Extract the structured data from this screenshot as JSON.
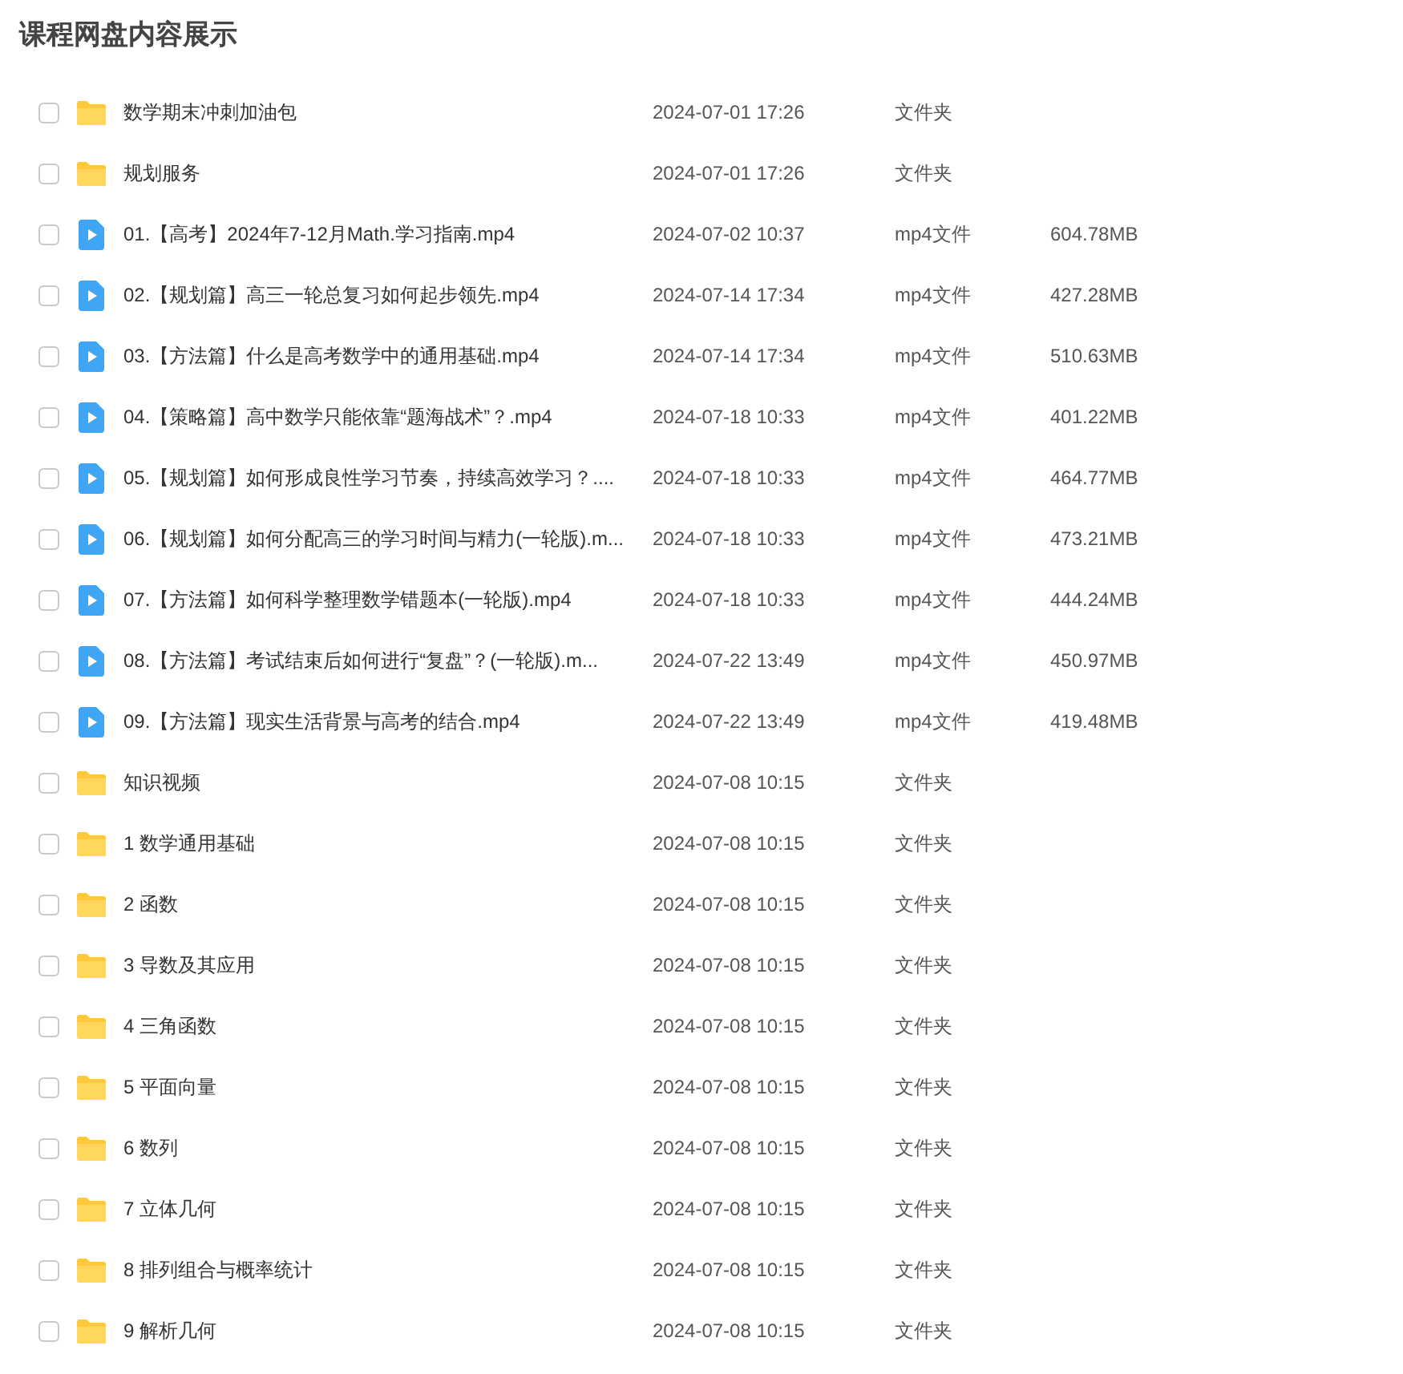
{
  "title": "课程网盘内容展示",
  "files": [
    {
      "kind": "folder",
      "checked": false,
      "name": "数学期末冲刺加油包",
      "date": "2024-07-01 17:26",
      "type": "文件夹"
    },
    {
      "kind": "folder",
      "checked": false,
      "name": "规划服务",
      "date": "2024-07-01 17:26",
      "type": "文件夹"
    },
    {
      "kind": "video",
      "checked": false,
      "name": "01.【高考】2024年7-12月Math.学习指南.mp4",
      "date": "2024-07-02 10:37",
      "type": "mp4文件",
      "size": "604.78MB"
    },
    {
      "kind": "video",
      "checked": false,
      "name": "02.【规划篇】高三一轮总复习如何起步领先.mp4",
      "date": "2024-07-14 17:34",
      "type": "mp4文件",
      "size": "427.28MB"
    },
    {
      "kind": "video",
      "checked": false,
      "name": "03.【方法篇】什么是高考数学中的通用基础.mp4",
      "date": "2024-07-14 17:34",
      "type": "mp4文件",
      "size": "510.63MB"
    },
    {
      "kind": "video",
      "checked": false,
      "name": "04.【策略篇】高中数学只能依靠“题海战术”？.mp4",
      "date": "2024-07-18 10:33",
      "type": "mp4文件",
      "size": "401.22MB"
    },
    {
      "kind": "video",
      "checked": false,
      "name": "05.【规划篇】如何形成良性学习节奏，持续高效学习？....",
      "date": "2024-07-18 10:33",
      "type": "mp4文件",
      "size": "464.77MB"
    },
    {
      "kind": "video",
      "checked": false,
      "name": "06.【规划篇】如何分配高三的学习时间与精力(一轮版).m...",
      "date": "2024-07-18 10:33",
      "type": "mp4文件",
      "size": "473.21MB"
    },
    {
      "kind": "video",
      "checked": false,
      "name": "07.【方法篇】如何科学整理数学错题本(一轮版).mp4",
      "date": "2024-07-18 10:33",
      "type": "mp4文件",
      "size": "444.24MB"
    },
    {
      "kind": "video",
      "checked": false,
      "name": "08.【方法篇】考试结束后如何进行“复盘”？(一轮版).m...",
      "date": "2024-07-22 13:49",
      "type": "mp4文件",
      "size": "450.97MB"
    },
    {
      "kind": "video",
      "checked": false,
      "name": "09.【方法篇】现实生活背景与高考的结合.mp4",
      "date": "2024-07-22 13:49",
      "type": "mp4文件",
      "size": "419.48MB"
    },
    {
      "kind": "folder",
      "checked": false,
      "name": "知识视频",
      "date": "2024-07-08 10:15",
      "type": "文件夹"
    },
    {
      "kind": "folder",
      "checked": false,
      "name": "1 数学通用基础",
      "date": "2024-07-08 10:15",
      "type": "文件夹"
    },
    {
      "kind": "folder",
      "checked": false,
      "name": "2 函数",
      "date": "2024-07-08 10:15",
      "type": "文件夹"
    },
    {
      "kind": "folder",
      "checked": false,
      "name": "3 导数及其应用",
      "date": "2024-07-08 10:15",
      "type": "文件夹"
    },
    {
      "kind": "folder",
      "checked": false,
      "name": "4 三角函数",
      "date": "2024-07-08 10:15",
      "type": "文件夹"
    },
    {
      "kind": "folder",
      "checked": false,
      "name": "5 平面向量",
      "date": "2024-07-08 10:15",
      "type": "文件夹"
    },
    {
      "kind": "folder",
      "checked": false,
      "name": "6 数列",
      "date": "2024-07-08 10:15",
      "type": "文件夹"
    },
    {
      "kind": "folder",
      "checked": false,
      "name": "7 立体几何",
      "date": "2024-07-08 10:15",
      "type": "文件夹"
    },
    {
      "kind": "folder",
      "checked": false,
      "name": "8 排列组合与概率统计",
      "date": "2024-07-08 10:15",
      "type": "文件夹"
    },
    {
      "kind": "folder",
      "checked": false,
      "name": "9 解析几何",
      "date": "2024-07-08 10:15",
      "type": "文件夹"
    }
  ]
}
